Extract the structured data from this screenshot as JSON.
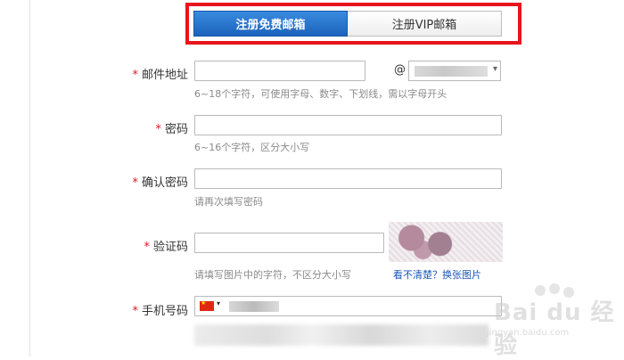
{
  "tabs": {
    "free_label": "注册免费邮箱",
    "vip_label": "注册VIP邮箱"
  },
  "form": {
    "required_mark": "*",
    "email": {
      "label": "邮件地址",
      "at": "@",
      "hint": "6~18个字符，可使用字母、数字、下划线，需以字母开头"
    },
    "password": {
      "label": "密码",
      "hint": "6~16个字符，区分大小写"
    },
    "confirm": {
      "label": "确认密码",
      "hint": "请再次填写密码"
    },
    "captcha": {
      "label": "验证码",
      "hint": "请填写图片中的字符，不区分大小写",
      "link": "看不清楚？换张图片"
    },
    "phone": {
      "label": "手机号码"
    }
  },
  "watermark": {
    "logo_text": "Bai du 经验",
    "url": "jingyan.baidu.com"
  },
  "colors": {
    "required": "#e8141d",
    "tab_active": "#1b63bc",
    "highlight": "#e8141d",
    "link": "#1a56b8"
  }
}
